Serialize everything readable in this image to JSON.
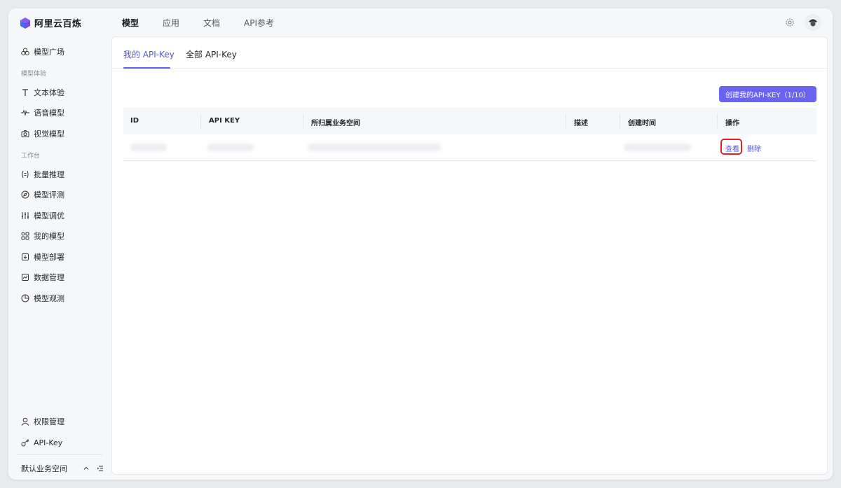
{
  "brand": {
    "name": "阿里云百炼"
  },
  "topnav": [
    "模型",
    "应用",
    "文档",
    "API参考"
  ],
  "sidebar": {
    "model_square": "模型广场",
    "group_experience": "模型体验",
    "text_experience": "文本体验",
    "speech_model": "语音模型",
    "vision_model": "视觉模型",
    "group_workbench": "工作台",
    "batch_inference": "批量推理",
    "model_eval": "模型评测",
    "model_tuning": "模型调优",
    "my_models": "我的模型",
    "model_deploy": "模型部署",
    "data_mgmt": "数据管理",
    "model_observe": "模型观测",
    "permission_mgmt": "权限管理",
    "api_key": "API-Key",
    "workspace": "默认业务空间"
  },
  "tabs": {
    "mine": "我的 API-Key",
    "all": "全部 API-Key"
  },
  "create_button": "创建我的API-KEY（1/10）",
  "table": {
    "headers": [
      "ID",
      "API KEY",
      "所归属业务空间",
      "描述",
      "创建时间",
      "操作"
    ],
    "row_actions": {
      "view": "查看",
      "delete": "删除"
    }
  },
  "colors": {
    "accent": "#615ced",
    "highlight": "#e02424"
  }
}
